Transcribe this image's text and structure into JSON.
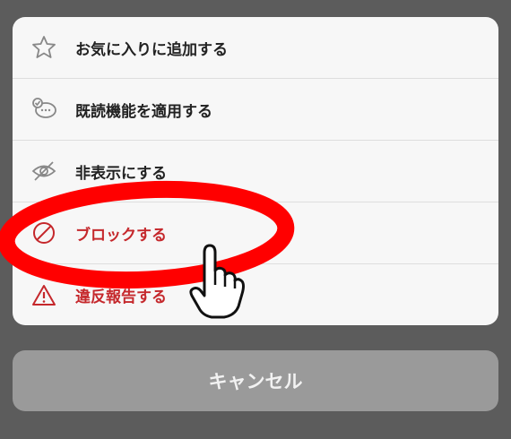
{
  "menu": {
    "items": [
      {
        "label": "お気に入りに追加する",
        "icon": "star-icon"
      },
      {
        "label": "既読機能を適用する",
        "icon": "chat-bubble-check-icon"
      },
      {
        "label": "非表示にする",
        "icon": "eye-slash-icon"
      },
      {
        "label": "ブロックする",
        "icon": "block-icon",
        "color": "#c5282c"
      },
      {
        "label": "違反報告する",
        "icon": "warning-icon",
        "color": "#c5282c"
      }
    ]
  },
  "cancel_label": "キャンセル",
  "annotation": {
    "highlight_color": "#ff0000",
    "target": "ブロックする"
  }
}
